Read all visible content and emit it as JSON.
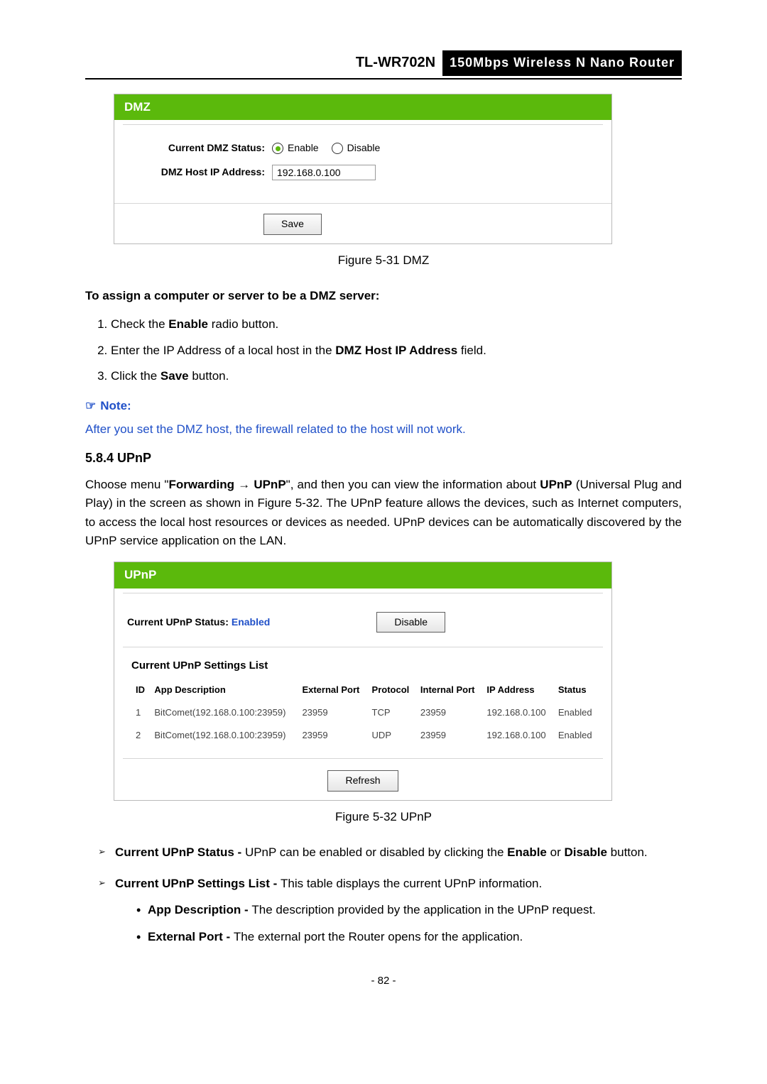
{
  "header": {
    "model": "TL-WR702N",
    "desc": "150Mbps  Wireless  N  Nano  Router"
  },
  "dmz_panel": {
    "title": "DMZ",
    "status_label": "Current DMZ Status:",
    "enable_label": "Enable",
    "disable_label": "Disable",
    "host_label": "DMZ Host IP Address:",
    "host_value": "192.168.0.100",
    "save_btn": "Save"
  },
  "fig_dmz": "Figure 5-31   DMZ",
  "assign_heading": "To assign a computer or server to be a DMZ server:",
  "steps": {
    "s1_a": "Check the ",
    "s1_b": "Enable",
    "s1_c": " radio button.",
    "s2_a": "Enter the IP Address of a local host in the ",
    "s2_b": "DMZ Host IP Address",
    "s2_c": " field.",
    "s3_a": "Click the ",
    "s3_b": "Save",
    "s3_c": " button."
  },
  "note": {
    "label": "Note:",
    "hand": "☞",
    "body": "After you set the DMZ host, the firewall related to the host will not work."
  },
  "section_584": "5.8.4  UPnP",
  "upnp_intro": {
    "a": "Choose  menu  \"",
    "b": "Forwarding",
    "arrow": "  →  ",
    "c": "UPnP",
    "d": "\",  and  then  you  can  view  the  information  about  ",
    "e": "UPnP",
    "f": " (Universal Plug and Play) in the screen as shown in Figure 5-32. The UPnP feature allows the devices, such as Internet computers, to access the local host resources or devices as needed. UPnP devices can be automatically discovered by the UPnP service application on the LAN."
  },
  "upnp_panel": {
    "title": "UPnP",
    "status_label": "Current UPnP Status: ",
    "status_value": "Enabled",
    "disable_btn": "Disable",
    "list_title": "Current UPnP Settings List",
    "headers": {
      "id": "ID",
      "app": "App Description",
      "ext": "External Port",
      "proto": "Protocol",
      "intp": "Internal Port",
      "ip": "IP Address",
      "status": "Status"
    },
    "rows": [
      {
        "id": "1",
        "app": "BitComet(192.168.0.100:23959)",
        "ext": "23959",
        "proto": "TCP",
        "intp": "23959",
        "ip": "192.168.0.100",
        "status": "Enabled"
      },
      {
        "id": "2",
        "app": "BitComet(192.168.0.100:23959)",
        "ext": "23959",
        "proto": "UDP",
        "intp": "23959",
        "ip": "192.168.0.100",
        "status": "Enabled"
      }
    ],
    "refresh_btn": "Refresh"
  },
  "fig_upnp": "Figure 5-32 UPnP",
  "bullets": {
    "b1_a": "Current UPnP Status - ",
    "b1_b": "UPnP can be enabled or disabled by clicking the ",
    "b1_c": "Enable",
    "b1_d": " or ",
    "b1_e": "Disable",
    "b1_f": " button.",
    "b2_a": "Current UPnP Settings List - ",
    "b2_b": "This table displays the current UPnP information.",
    "sub1_a": "App Description - ",
    "sub1_b": "The description provided by the application in the UPnP request.",
    "sub2_a": "External Port - ",
    "sub2_b": "The external port the Router opens for the application."
  },
  "page_num": "- 82 -"
}
